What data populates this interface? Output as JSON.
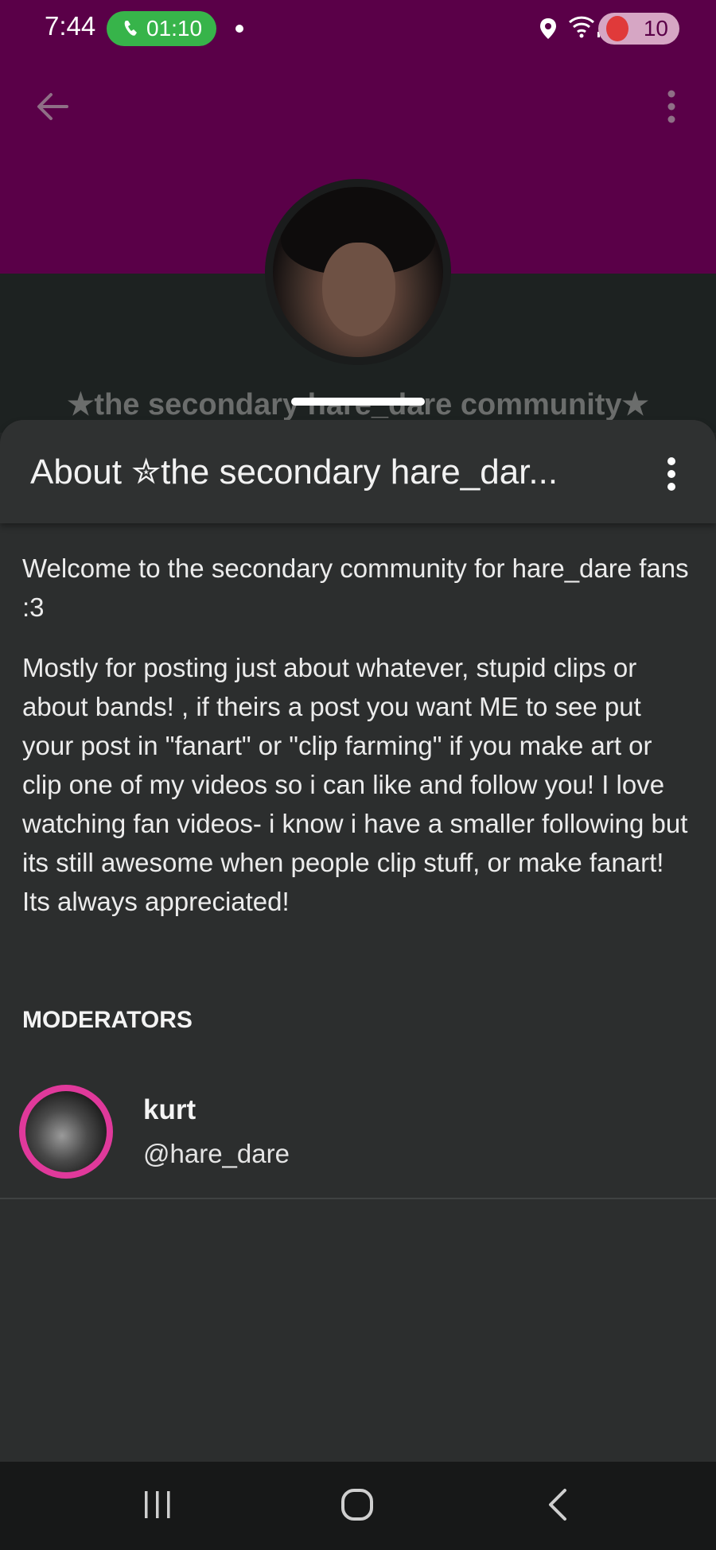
{
  "status_bar": {
    "time": "7:44",
    "call_duration": "01:10",
    "battery": "10"
  },
  "header": {
    "community_title": "★the secondary hare_dare community★",
    "accent_color": "#5a0048"
  },
  "sheet": {
    "title": "About ✮the secondary hare_dar...",
    "welcome_text": "Welcome to the secondary community for hare_dare fans :3",
    "description": "Mostly for posting  just about whatever, stupid clips or about bands! , if theirs a post you want ME to see put your post in \"fanart\" or \"clip farming\" if you make art or clip one of my videos so i can like and follow you! I love watching fan videos- i know i have a smaller following but its still awesome when people clip stuff, or make fanart! Its always appreciated!"
  },
  "moderators": {
    "heading": "MODERATORS",
    "items": [
      {
        "name": "kurt",
        "handle": "@hare_dare",
        "ring_color": "#e0399b"
      }
    ]
  },
  "icons": {
    "back": "arrow-left-icon",
    "menu": "more-vertical-icon",
    "nav_recent": "recent-apps-icon",
    "nav_home": "home-icon",
    "nav_back": "chevron-left-icon"
  }
}
